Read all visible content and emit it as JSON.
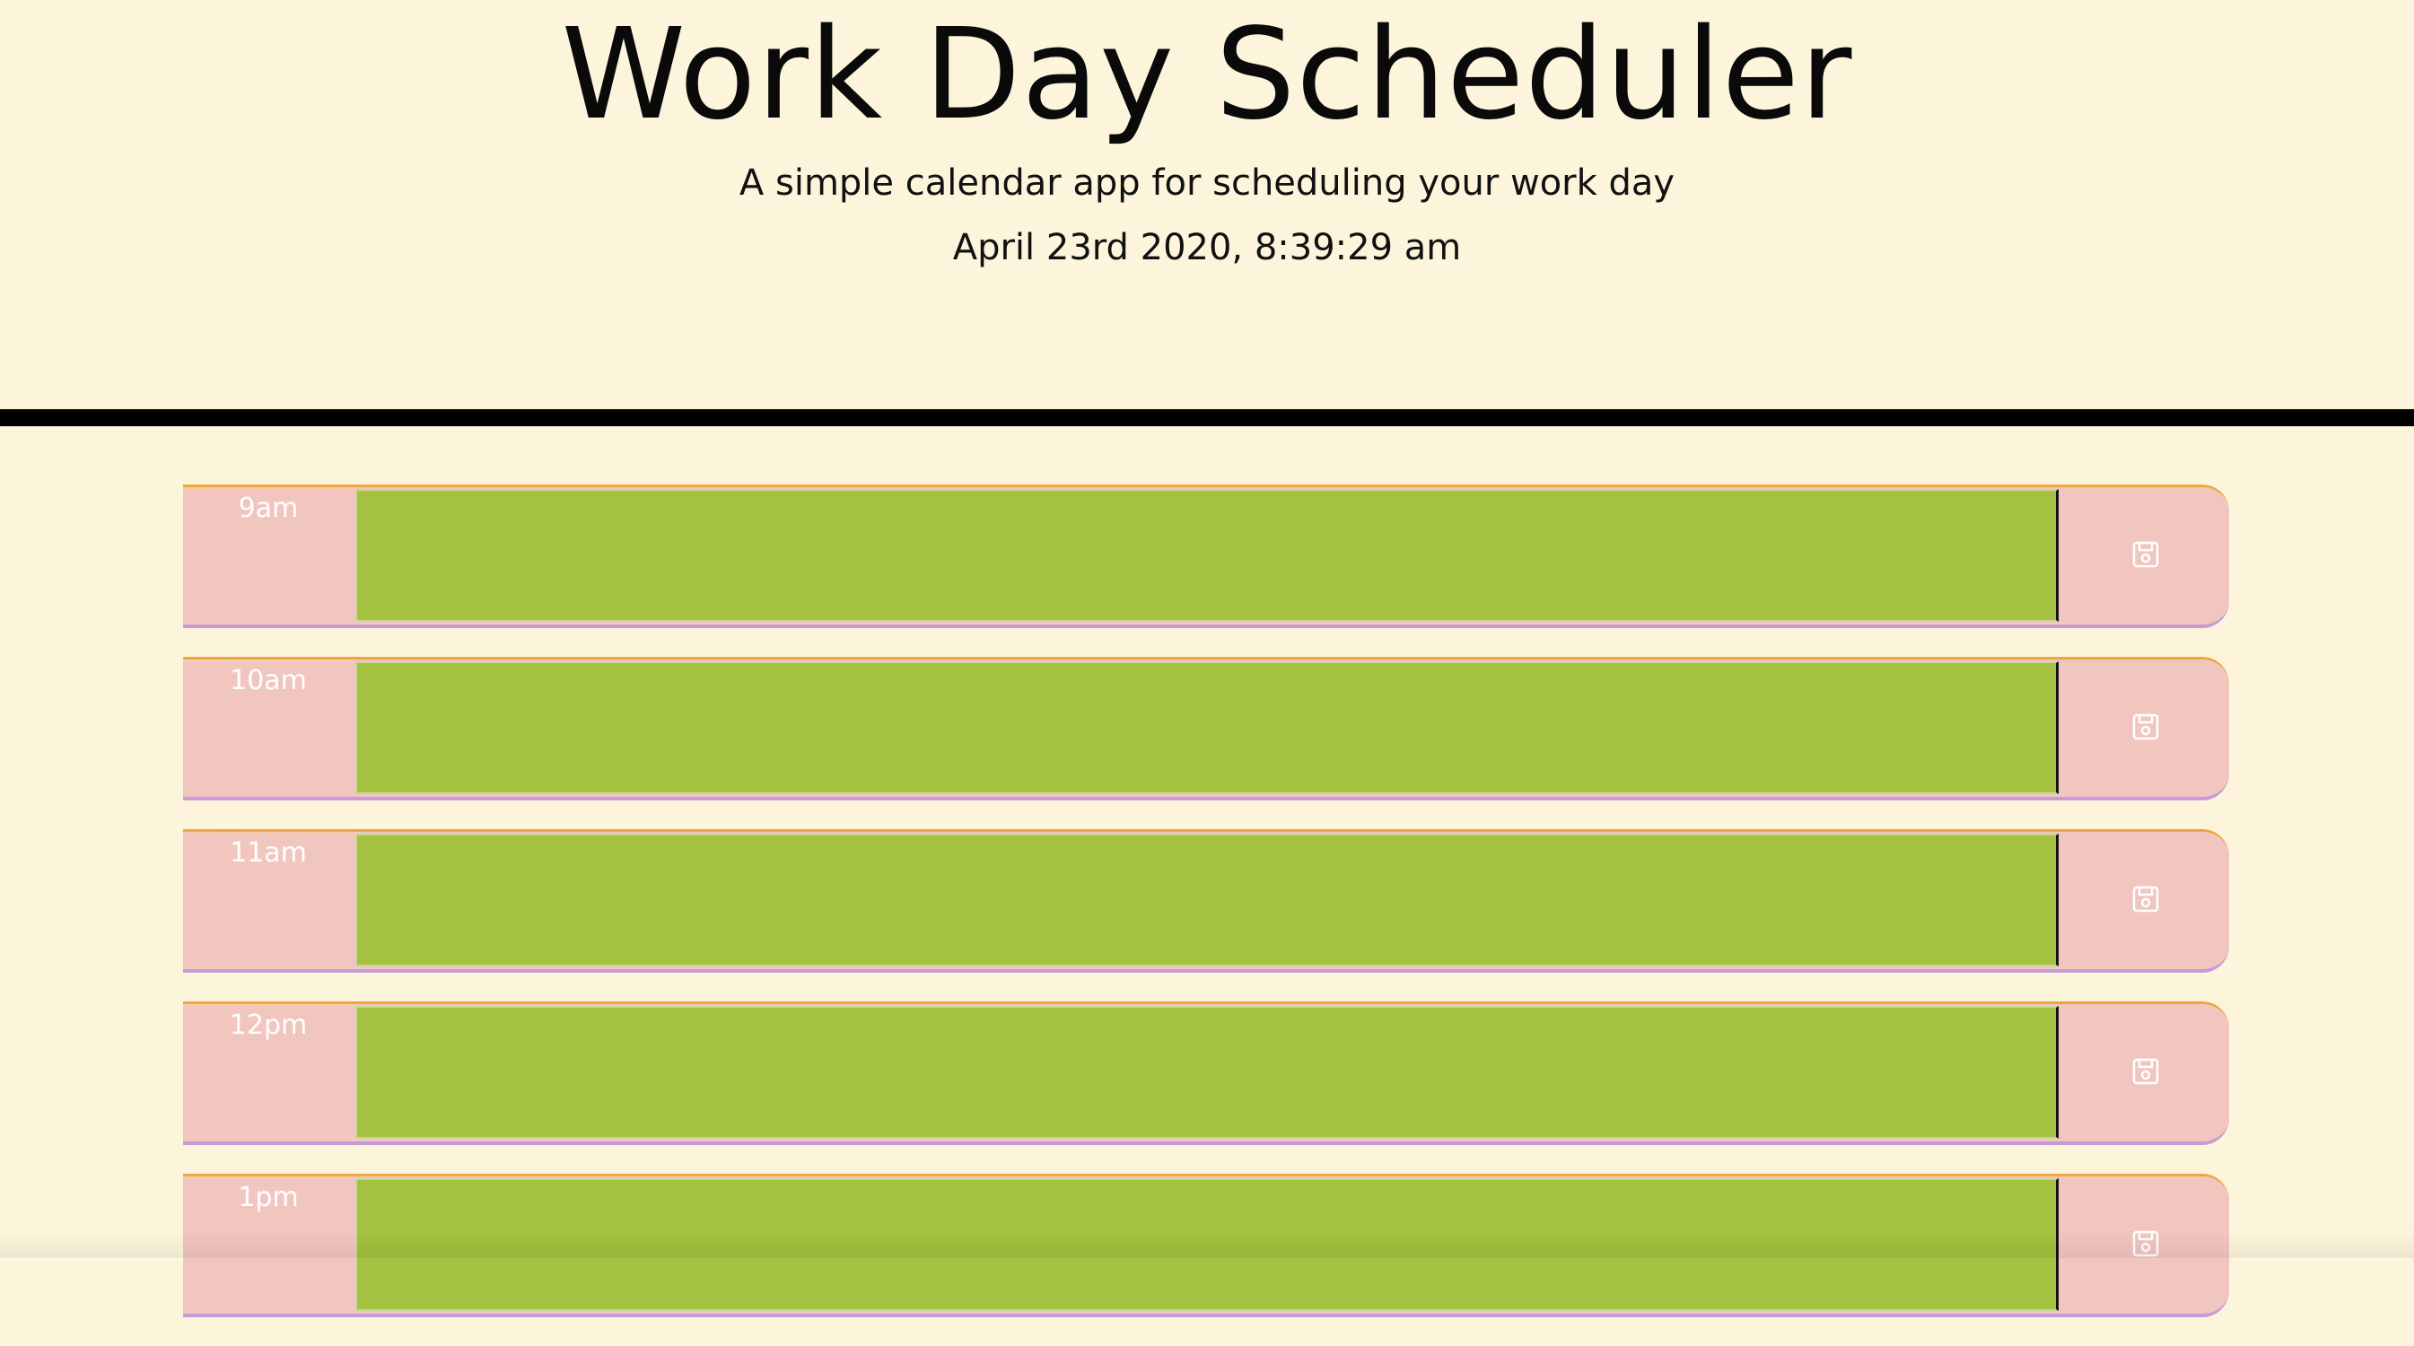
{
  "header": {
    "title": "Work Day Scheduler",
    "lead": "A simple calendar app for scheduling your work day",
    "current_datetime": "April 23rd 2020, 8:39:29 am"
  },
  "colors": {
    "background": "#fdf5db",
    "hour_block": "#f1c6bf",
    "future_textarea": "#a4c13f",
    "divider": "#000000",
    "border_top_accent": "#f0a63c",
    "border_bottom_accent": "#c79bd8"
  },
  "time_blocks": [
    {
      "hour": "9am",
      "description": "",
      "save_icon": "save-icon"
    },
    {
      "hour": "10am",
      "description": "",
      "save_icon": "save-icon"
    },
    {
      "hour": "11am",
      "description": "",
      "save_icon": "save-icon"
    },
    {
      "hour": "12pm",
      "description": "",
      "save_icon": "save-icon"
    },
    {
      "hour": "1pm",
      "description": "",
      "save_icon": "save-icon"
    }
  ]
}
